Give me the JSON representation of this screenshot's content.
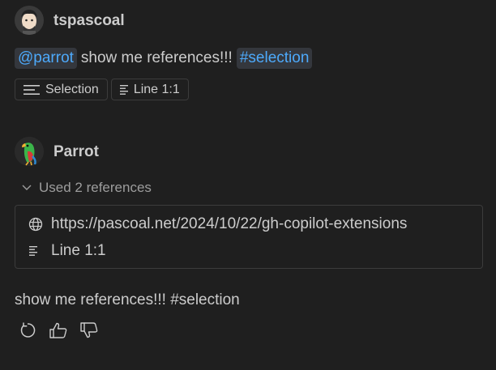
{
  "user": {
    "name": "tspascoal",
    "avatar_icon": "user-avatar"
  },
  "user_message": {
    "mention": "@parrot",
    "text": "show me references!!!",
    "variable": "#selection"
  },
  "context_chips": [
    {
      "label": "Selection",
      "icon": "selection-icon"
    },
    {
      "label": "Line 1:1",
      "icon": "lines-icon"
    }
  ],
  "agent": {
    "name": "Parrot",
    "avatar_icon": "parrot-avatar"
  },
  "references": {
    "summary": "Used 2 references",
    "items": [
      {
        "label": "https://pascoal.net/2024/10/22/gh-copilot-extensions",
        "icon": "globe-icon"
      },
      {
        "label": "Line 1:1",
        "icon": "lines-icon"
      }
    ]
  },
  "response": {
    "text": "show me references!!! #selection"
  },
  "actions": [
    {
      "name": "retry",
      "icon": "refresh-icon"
    },
    {
      "name": "helpful",
      "icon": "thumbs-up-icon"
    },
    {
      "name": "unhelpful",
      "icon": "thumbs-down-icon"
    }
  ],
  "colors": {
    "background": "#1f1f1f",
    "text": "#cccccc",
    "muted": "#9d9d9d",
    "link": "#4daafc",
    "chip_bg": "#34373d",
    "border": "#3c3c3c"
  }
}
